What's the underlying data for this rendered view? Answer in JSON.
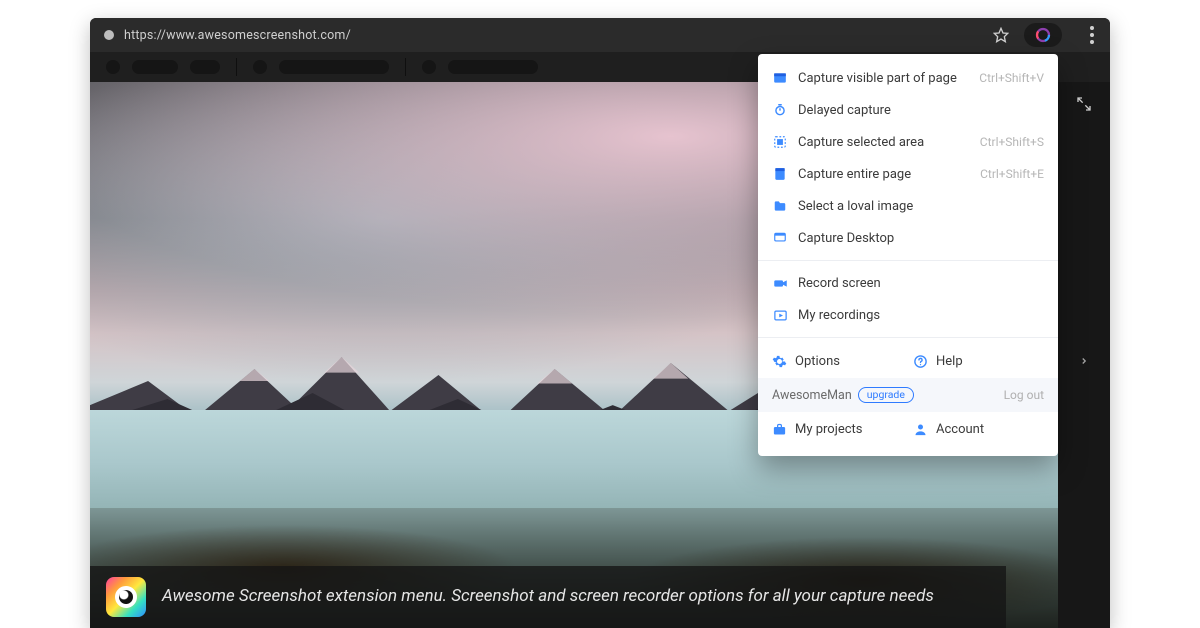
{
  "browser": {
    "url": "https://www.awesomescreenshot.com/"
  },
  "popup": {
    "items": [
      {
        "id": "capture-visible",
        "label": "Capture visible part of page",
        "shortcut": "Ctrl+Shift+V",
        "icon": "window"
      },
      {
        "id": "delayed-capture",
        "label": "Delayed capture",
        "shortcut": "",
        "icon": "timer",
        "indent": true
      },
      {
        "id": "capture-selected",
        "label": "Capture selected area",
        "shortcut": "Ctrl+Shift+S",
        "icon": "crop"
      },
      {
        "id": "capture-entire",
        "label": "Capture entire page",
        "shortcut": "Ctrl+Shift+E",
        "icon": "page"
      },
      {
        "id": "select-local",
        "label": "Select a loval image",
        "shortcut": "",
        "icon": "folder"
      },
      {
        "id": "capture-desktop",
        "label": "Capture Desktop",
        "shortcut": "",
        "icon": "desktop"
      }
    ],
    "record": [
      {
        "id": "record-screen",
        "label": "Record screen",
        "icon": "camera"
      },
      {
        "id": "my-recordings",
        "label": "My recordings",
        "icon": "recordings"
      }
    ],
    "options_label": "Options",
    "help_label": "Help",
    "user_name": "AwesomeMan",
    "upgrade_label": "upgrade",
    "logout_label": "Log out",
    "my_projects_label": "My projects",
    "account_label": "Account"
  },
  "caption": {
    "text": "Awesome Screenshot extension menu.  Screenshot and screen recorder options for all your capture needs"
  }
}
